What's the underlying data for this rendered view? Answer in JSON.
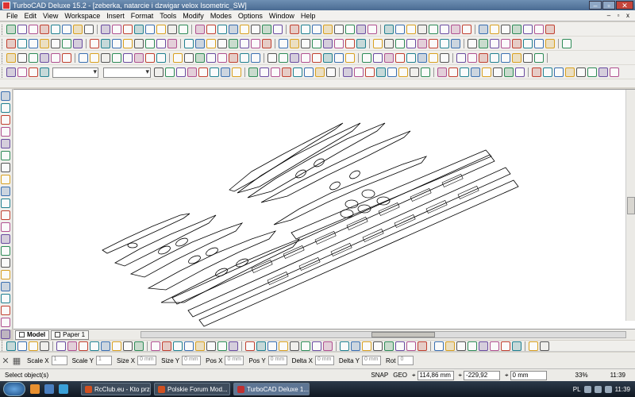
{
  "window": {
    "title": "TurboCAD Deluxe 15.2 - [zeberka, natarcie i dzwigar velox Isometric_SW]",
    "buttons": {
      "minimize": "–",
      "maximize": "▫",
      "close": "✕"
    }
  },
  "menu": [
    "File",
    "Edit",
    "View",
    "Workspace",
    "Insert",
    "Format",
    "Tools",
    "Modify",
    "Modes",
    "Options",
    "Window",
    "Help"
  ],
  "mdi_buttons": {
    "minimize": "–",
    "restore": "▫",
    "close": "x"
  },
  "sheet_tabs": [
    {
      "label": "Model",
      "active": true
    },
    {
      "label": "Paper 1",
      "active": false
    }
  ],
  "inspector": {
    "fields": [
      {
        "label": "Scale X",
        "value": "1"
      },
      {
        "label": "Scale Y",
        "value": "1"
      },
      {
        "label": "Size X",
        "value": "0 mm"
      },
      {
        "label": "Size Y",
        "value": "0 mm"
      },
      {
        "label": "Pos X",
        "value": "0 mm"
      },
      {
        "label": "Pos Y",
        "value": "0 mm"
      },
      {
        "label": "Delta X",
        "value": "0 mm"
      },
      {
        "label": "Delta Y",
        "value": "0 mm"
      },
      {
        "label": "Rot",
        "value": "0"
      }
    ]
  },
  "status": {
    "message": "Select object(s)",
    "snap": "SNAP",
    "geo": "GEO",
    "x": "114,86 mm",
    "y": "-229,92 mm",
    "z": "0 mm",
    "zoom": "33%",
    "time": "11:39"
  },
  "taskbar": {
    "tasks": [
      {
        "label": "RcClub.eu - Kto prz...",
        "icon_color": "#d05020",
        "active": false
      },
      {
        "label": "Polskie Forum Mod...",
        "icon_color": "#d05020",
        "active": false
      },
      {
        "label": "TurboCAD Deluxe 1...",
        "icon_color": "#c03030",
        "active": true
      }
    ],
    "tray": {
      "lang": "PL",
      "time": "11:39"
    }
  },
  "icons": {
    "app": "turbocad-icon",
    "start": "windows-start-icon"
  },
  "colors": {
    "title_bar": "#4a6b92",
    "canvas": "#ffffff",
    "drawing_lines": "#000000"
  }
}
